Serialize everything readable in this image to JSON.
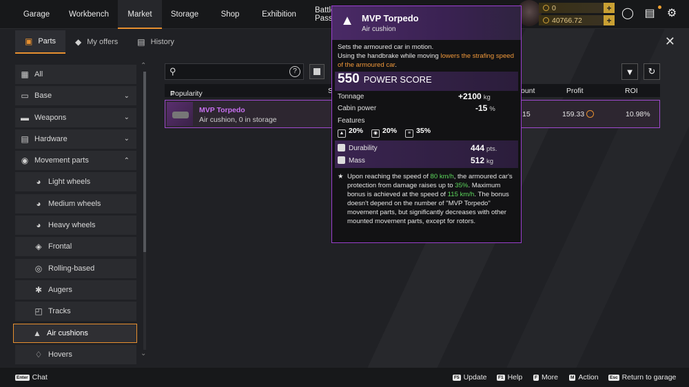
{
  "topnav": {
    "tabs": [
      {
        "label": "Garage"
      },
      {
        "label": "Workbench"
      },
      {
        "label": "Market",
        "active": true
      },
      {
        "label": "Storage"
      },
      {
        "label": "Shop"
      },
      {
        "label": "Exhibition"
      },
      {
        "label": "Battle Pass"
      }
    ],
    "currency": {
      "primary": "0",
      "secondary": "40766.72"
    },
    "icons": [
      "speedometer-icon",
      "news-icon",
      "settings-icon"
    ]
  },
  "subnav": {
    "tabs": [
      {
        "label": "Parts",
        "icon": "parts-icon",
        "active": true
      },
      {
        "label": "My offers",
        "icon": "tag-icon"
      },
      {
        "label": "History",
        "icon": "history-icon"
      }
    ]
  },
  "sidebar": {
    "items": [
      {
        "label": "All",
        "icon": "grid-icon"
      },
      {
        "label": "Base",
        "icon": "frame-icon",
        "chevron": "down"
      },
      {
        "label": "Weapons",
        "icon": "gun-icon",
        "chevron": "down"
      },
      {
        "label": "Hardware",
        "icon": "hardware-icon",
        "chevron": "down"
      },
      {
        "label": "Movement parts",
        "icon": "wheel-icon",
        "chevron": "up"
      },
      {
        "label": "Light wheels",
        "sub": true
      },
      {
        "label": "Medium wheels",
        "sub": true
      },
      {
        "label": "Heavy wheels",
        "sub": true
      },
      {
        "label": "Frontal",
        "sub": true
      },
      {
        "label": "Rolling-based",
        "sub": true
      },
      {
        "label": "Augers",
        "sub": true
      },
      {
        "label": "Tracks",
        "sub": true
      },
      {
        "label": "Air cushions",
        "sub": true,
        "selected": true
      },
      {
        "label": "Hovers",
        "sub": true
      }
    ]
  },
  "table": {
    "headers": {
      "popularity": "Popularity",
      "s": "S",
      "amount": "ount",
      "profit": "Profit",
      "roi": "ROI"
    },
    "row": {
      "name": "MVP Torpedo",
      "sub": "Air cushion, 0 in storage",
      "amount": "15",
      "profit": "159.33",
      "roi": "10.98%"
    }
  },
  "tooltip": {
    "title": "MVP Torpedo",
    "subtitle": "Air cushion",
    "desc_1": "Sets the armoured car in motion.",
    "desc_2": "Using the handbrake while moving ",
    "desc_hl": "lowers the strafing speed of the armoured car",
    "desc_end": ".",
    "power_score": "550",
    "power_label": "POWER SCORE",
    "tonnage_label": "Tonnage",
    "tonnage_value": "+2100",
    "tonnage_unit": "kg",
    "cabin_label": "Cabin power",
    "cabin_value": "-15",
    "cabin_unit": "%",
    "features_label": "Features",
    "features": [
      "20%",
      "20%",
      "35%"
    ],
    "durability_label": "Durability",
    "durability_value": "444",
    "durability_unit": "pts.",
    "mass_label": "Mass",
    "mass_value": "512",
    "mass_unit": "kg",
    "bonus": {
      "p1": "Upon reaching the speed of ",
      "v1": "80 km/h",
      "p2": ", the armoured car's protection from damage raises up to ",
      "v2": "35%",
      "p3": ". Maximum bonus is achieved at the speed of ",
      "v3": "115 km/h",
      "p4": ". The bonus doesn't depend on the number of \"MVP Torpedo\" movement parts, but significantly decreases with other mounted movement parts, except for rotors."
    }
  },
  "bottombar": {
    "chat_key": "Enter",
    "chat": "Chat",
    "update_key": "F5",
    "update": "Update",
    "help_key": "F1",
    "help": "Help",
    "more_key": "F",
    "more": "More",
    "action_key": "M",
    "action": "Action",
    "return_key": "Esc",
    "return": "Return to garage"
  },
  "colors": {
    "accent": "#e8902f",
    "rarity": "#a14ad0",
    "highlight": "#f0983a",
    "bonus": "#5cd65c"
  }
}
